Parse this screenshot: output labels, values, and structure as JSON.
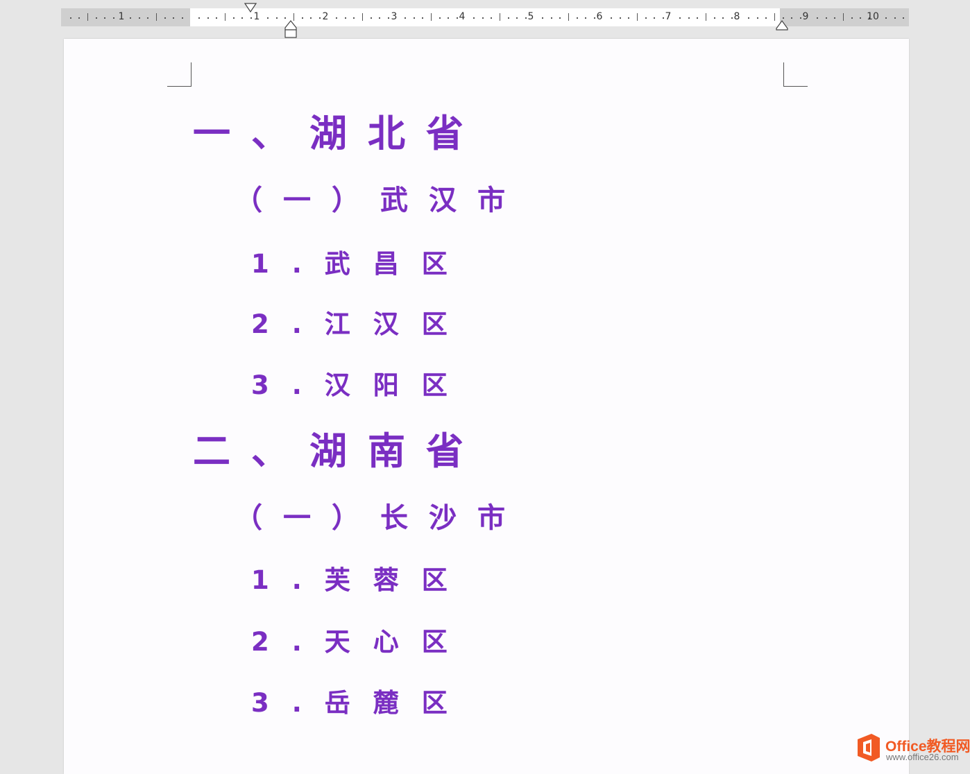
{
  "ruler": {
    "numbers": [
      "1",
      "1",
      "2",
      "3",
      "4",
      "5",
      "6",
      "7",
      "8",
      "9",
      "10"
    ]
  },
  "document": {
    "sections": [
      {
        "heading": "一、湖北省",
        "subheading": "（一）武汉市",
        "items": [
          "1.武昌区",
          "2.江汉区",
          "3.汉阳区"
        ]
      },
      {
        "heading": "二、湖南省",
        "subheading": "（一）长沙市",
        "items": [
          "1.芙蓉区",
          "2.天心区",
          "3.岳麓区"
        ]
      }
    ]
  },
  "watermark": {
    "title": "Office教程网",
    "url": "www.office26.com"
  },
  "colors": {
    "text_accent": "#7a2ec2",
    "logo_orange": "#f15a24"
  }
}
